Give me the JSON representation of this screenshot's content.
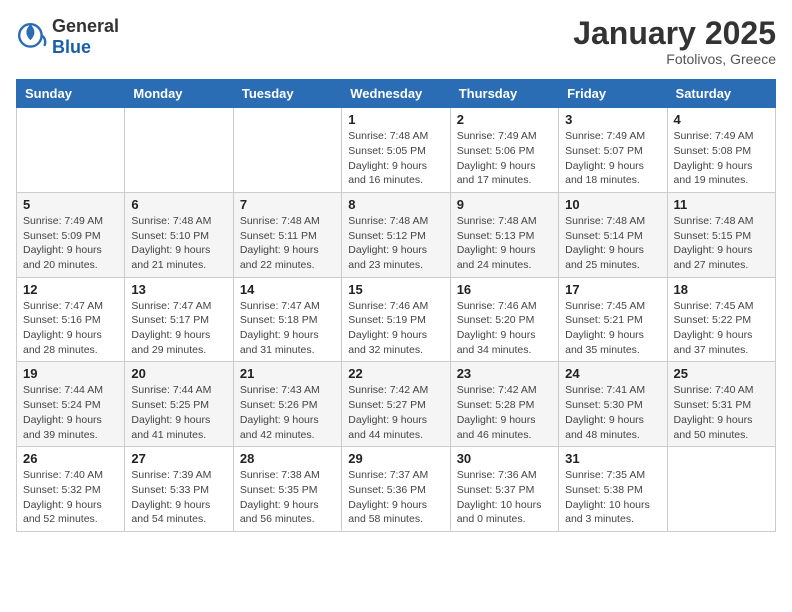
{
  "logo": {
    "general": "General",
    "blue": "Blue"
  },
  "title": "January 2025",
  "location": "Fotolivos, Greece",
  "days_header": [
    "Sunday",
    "Monday",
    "Tuesday",
    "Wednesday",
    "Thursday",
    "Friday",
    "Saturday"
  ],
  "weeks": [
    [
      {
        "day": "",
        "info": ""
      },
      {
        "day": "",
        "info": ""
      },
      {
        "day": "",
        "info": ""
      },
      {
        "day": "1",
        "info": "Sunrise: 7:48 AM\nSunset: 5:05 PM\nDaylight: 9 hours\nand 16 minutes."
      },
      {
        "day": "2",
        "info": "Sunrise: 7:49 AM\nSunset: 5:06 PM\nDaylight: 9 hours\nand 17 minutes."
      },
      {
        "day": "3",
        "info": "Sunrise: 7:49 AM\nSunset: 5:07 PM\nDaylight: 9 hours\nand 18 minutes."
      },
      {
        "day": "4",
        "info": "Sunrise: 7:49 AM\nSunset: 5:08 PM\nDaylight: 9 hours\nand 19 minutes."
      }
    ],
    [
      {
        "day": "5",
        "info": "Sunrise: 7:49 AM\nSunset: 5:09 PM\nDaylight: 9 hours\nand 20 minutes."
      },
      {
        "day": "6",
        "info": "Sunrise: 7:48 AM\nSunset: 5:10 PM\nDaylight: 9 hours\nand 21 minutes."
      },
      {
        "day": "7",
        "info": "Sunrise: 7:48 AM\nSunset: 5:11 PM\nDaylight: 9 hours\nand 22 minutes."
      },
      {
        "day": "8",
        "info": "Sunrise: 7:48 AM\nSunset: 5:12 PM\nDaylight: 9 hours\nand 23 minutes."
      },
      {
        "day": "9",
        "info": "Sunrise: 7:48 AM\nSunset: 5:13 PM\nDaylight: 9 hours\nand 24 minutes."
      },
      {
        "day": "10",
        "info": "Sunrise: 7:48 AM\nSunset: 5:14 PM\nDaylight: 9 hours\nand 25 minutes."
      },
      {
        "day": "11",
        "info": "Sunrise: 7:48 AM\nSunset: 5:15 PM\nDaylight: 9 hours\nand 27 minutes."
      }
    ],
    [
      {
        "day": "12",
        "info": "Sunrise: 7:47 AM\nSunset: 5:16 PM\nDaylight: 9 hours\nand 28 minutes."
      },
      {
        "day": "13",
        "info": "Sunrise: 7:47 AM\nSunset: 5:17 PM\nDaylight: 9 hours\nand 29 minutes."
      },
      {
        "day": "14",
        "info": "Sunrise: 7:47 AM\nSunset: 5:18 PM\nDaylight: 9 hours\nand 31 minutes."
      },
      {
        "day": "15",
        "info": "Sunrise: 7:46 AM\nSunset: 5:19 PM\nDaylight: 9 hours\nand 32 minutes."
      },
      {
        "day": "16",
        "info": "Sunrise: 7:46 AM\nSunset: 5:20 PM\nDaylight: 9 hours\nand 34 minutes."
      },
      {
        "day": "17",
        "info": "Sunrise: 7:45 AM\nSunset: 5:21 PM\nDaylight: 9 hours\nand 35 minutes."
      },
      {
        "day": "18",
        "info": "Sunrise: 7:45 AM\nSunset: 5:22 PM\nDaylight: 9 hours\nand 37 minutes."
      }
    ],
    [
      {
        "day": "19",
        "info": "Sunrise: 7:44 AM\nSunset: 5:24 PM\nDaylight: 9 hours\nand 39 minutes."
      },
      {
        "day": "20",
        "info": "Sunrise: 7:44 AM\nSunset: 5:25 PM\nDaylight: 9 hours\nand 41 minutes."
      },
      {
        "day": "21",
        "info": "Sunrise: 7:43 AM\nSunset: 5:26 PM\nDaylight: 9 hours\nand 42 minutes."
      },
      {
        "day": "22",
        "info": "Sunrise: 7:42 AM\nSunset: 5:27 PM\nDaylight: 9 hours\nand 44 minutes."
      },
      {
        "day": "23",
        "info": "Sunrise: 7:42 AM\nSunset: 5:28 PM\nDaylight: 9 hours\nand 46 minutes."
      },
      {
        "day": "24",
        "info": "Sunrise: 7:41 AM\nSunset: 5:30 PM\nDaylight: 9 hours\nand 48 minutes."
      },
      {
        "day": "25",
        "info": "Sunrise: 7:40 AM\nSunset: 5:31 PM\nDaylight: 9 hours\nand 50 minutes."
      }
    ],
    [
      {
        "day": "26",
        "info": "Sunrise: 7:40 AM\nSunset: 5:32 PM\nDaylight: 9 hours\nand 52 minutes."
      },
      {
        "day": "27",
        "info": "Sunrise: 7:39 AM\nSunset: 5:33 PM\nDaylight: 9 hours\nand 54 minutes."
      },
      {
        "day": "28",
        "info": "Sunrise: 7:38 AM\nSunset: 5:35 PM\nDaylight: 9 hours\nand 56 minutes."
      },
      {
        "day": "29",
        "info": "Sunrise: 7:37 AM\nSunset: 5:36 PM\nDaylight: 9 hours\nand 58 minutes."
      },
      {
        "day": "30",
        "info": "Sunrise: 7:36 AM\nSunset: 5:37 PM\nDaylight: 10 hours\nand 0 minutes."
      },
      {
        "day": "31",
        "info": "Sunrise: 7:35 AM\nSunset: 5:38 PM\nDaylight: 10 hours\nand 3 minutes."
      },
      {
        "day": "",
        "info": ""
      }
    ]
  ]
}
